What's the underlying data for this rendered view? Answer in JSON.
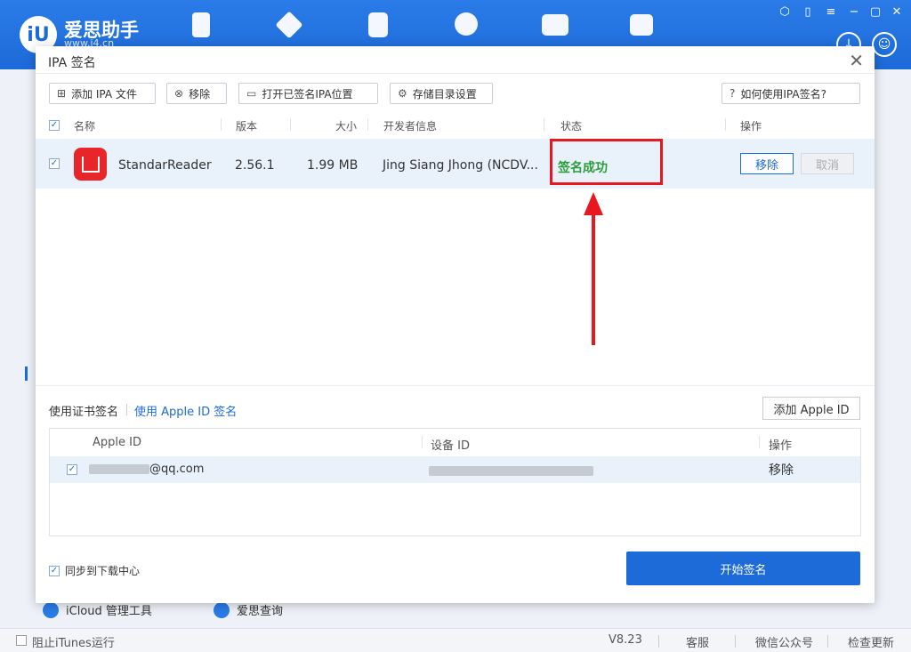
{
  "app": {
    "logo_text": "iU",
    "title": "爱思助手",
    "url": "www.i4.cn",
    "window_controls": [
      "⬡",
      "▯",
      "−",
      "▢",
      "✕"
    ]
  },
  "background": {
    "bottom_items": [
      {
        "label": "iCloud 管理工具"
      },
      {
        "label": "爱思查询"
      }
    ]
  },
  "statusbar": {
    "block_itunes": "阻止iTunes运行",
    "version": "V8.23",
    "support": "客服",
    "wechat": "微信公众号",
    "update": "检查更新"
  },
  "dialog": {
    "title": "IPA 签名",
    "close": "✕",
    "toolbar": {
      "add_ipa": "添加 IPA 文件",
      "remove": "移除",
      "open_signed": "打开已签名IPA位置",
      "storage_settings": "存储目录设置",
      "help": "如何使用IPA签名?"
    },
    "table": {
      "headers": {
        "name": "名称",
        "version": "版本",
        "size": "大小",
        "developer": "开发者信息",
        "status": "状态",
        "action": "操作"
      },
      "rows": [
        {
          "name": "StandarReader",
          "version": "2.56.1",
          "size": "1.99 MB",
          "developer": "Jing Siang Jhong (NCDV...",
          "status": "签名成功",
          "remove_label": "移除",
          "cancel_label": "取消"
        }
      ]
    },
    "sign_tabs": {
      "cert": "使用证书签名",
      "appleid": "使用 Apple ID 签名"
    },
    "add_appleid": "添加 Apple ID",
    "appleid_table": {
      "headers": {
        "appleid": "Apple ID",
        "device": "设备 ID",
        "action": "操作"
      },
      "rows": [
        {
          "appleid_suffix": "@qq.com",
          "remove_label": "移除"
        }
      ]
    },
    "sync_download": "同步到下载中心",
    "start_sign": "开始签名"
  },
  "colors": {
    "brand": "#1d6ad9",
    "success": "#2a9d3a",
    "annotation": "#e8191e"
  }
}
